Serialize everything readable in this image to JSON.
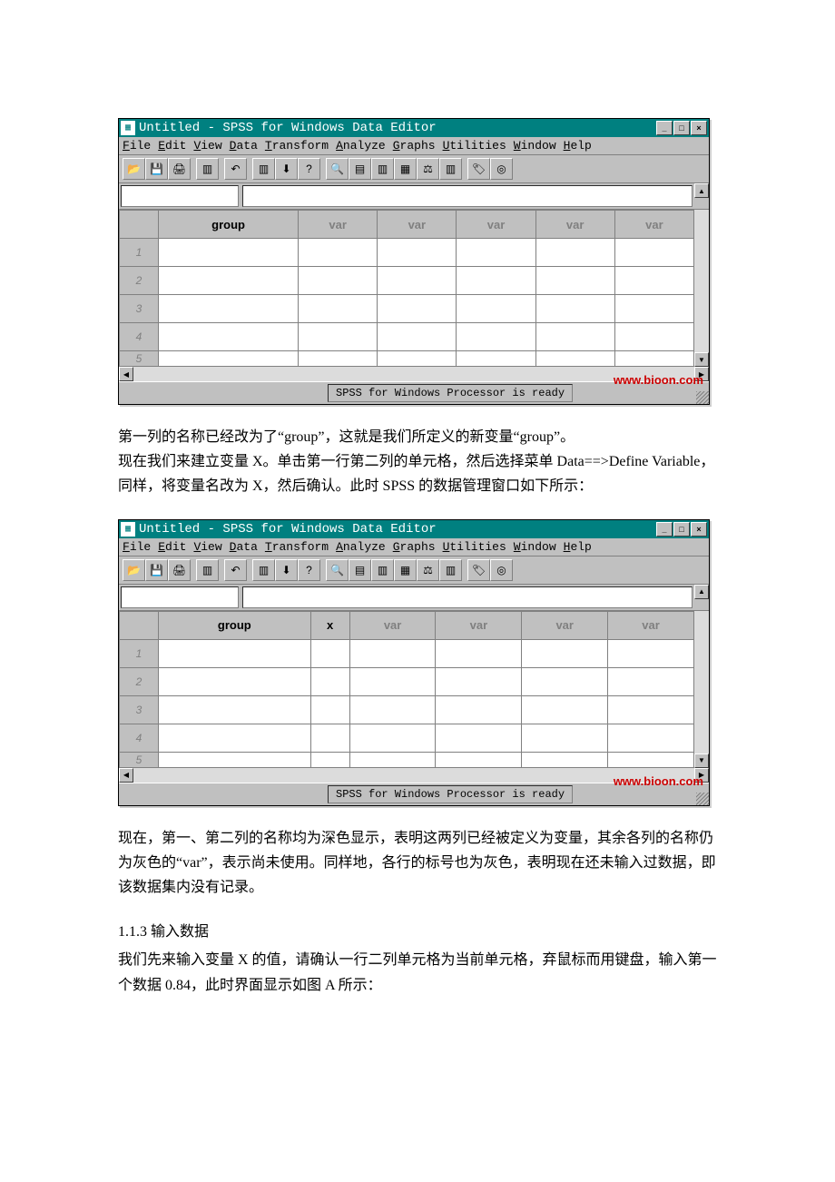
{
  "window": {
    "title": "Untitled - SPSS for Windows Data Editor",
    "minimize": "_",
    "maximize": "□",
    "close": "×"
  },
  "menu": {
    "file": "File",
    "edit": "Edit",
    "view": "View",
    "data": "Data",
    "transform": "Transform",
    "analyze": "Analyze",
    "graphs": "Graphs",
    "utilities": "Utilities",
    "window": "Window",
    "help": "Help"
  },
  "grid1": {
    "cols": [
      "group",
      "var",
      "var",
      "var",
      "var",
      "var"
    ],
    "col_defined": [
      true,
      false,
      false,
      false,
      false,
      false
    ],
    "rows": [
      "1",
      "2",
      "3",
      "4",
      "5"
    ]
  },
  "grid2": {
    "cols": [
      "group",
      "x",
      "var",
      "var",
      "var",
      "var"
    ],
    "col_defined": [
      true,
      true,
      false,
      false,
      false,
      false
    ],
    "rows": [
      "1",
      "2",
      "3",
      "4",
      "5"
    ]
  },
  "status": "SPSS for Windows Processor is ready",
  "watermark": "www.bioon.com",
  "text": {
    "p1": "第一列的名称已经改为了“group”，这就是我们所定义的新变量“group”。",
    "p2": "现在我们来建立变量 X。单击第一行第二列的单元格，然后选择菜单 Data==>Define Variable，同样，将变量名改为 X，然后确认。此时 SPSS 的数据管理窗口如下所示：",
    "p3": "现在，第一、第二列的名称均为深色显示，表明这两列已经被定义为变量，其余各列的名称仍为灰色的“var”，表示尚未使用。同样地，各行的标号也为灰色，表明现在还未输入过数据，即该数据集内没有记录。",
    "h113": "1.1.3 输入数据",
    "p4": "我们先来输入变量 X 的值，请确认一行二列单元格为当前单元格，弃鼠标而用键盘，输入第一个数据 0.84，此时界面显示如图 A 所示："
  }
}
